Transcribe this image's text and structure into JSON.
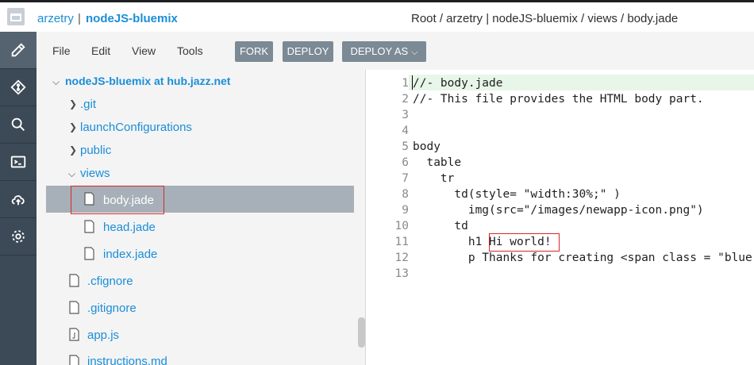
{
  "header": {
    "user": "arzetry",
    "separator": "|",
    "project": "nodeJS-bluemix",
    "path": "Root / arzetry | nodeJS-bluemix / views / body.jade"
  },
  "toolbar": {
    "menus": [
      "File",
      "Edit",
      "View",
      "Tools"
    ],
    "fork_label": "FORK",
    "deploy_label": "DEPLOY",
    "deploy_as_label": "DEPLOY AS"
  },
  "rail": {
    "icons": [
      "edit-icon",
      "git-icon",
      "search-icon",
      "terminal-icon",
      "cloud-upload-icon",
      "settings-icon"
    ]
  },
  "tree": {
    "root": "nodeJS-bluemix at hub.jazz.net",
    "folders": [
      ".git",
      "launchConfigurations",
      "public",
      "views"
    ],
    "views_files": [
      "body.jade",
      "head.jade",
      "index.jade"
    ],
    "root_files": [
      ".cfignore",
      ".gitignore",
      "app.js",
      "instructions.md"
    ],
    "selected": "body.jade"
  },
  "editor": {
    "line_numbers": [
      "1",
      "2",
      "3",
      "4",
      "5",
      "6",
      "7",
      "8",
      "9",
      "10",
      "11",
      "12",
      "13"
    ],
    "lines": [
      "//- body.jade",
      "//- This file provides the HTML body part.",
      "",
      "",
      "body",
      "  table",
      "    tr",
      "      td(style= \"width:30%;\" )",
      "        img(src=\"/images/newapp-icon.png\")",
      "      td",
      "        h1 Hi world!",
      "        p Thanks for creating <span class = \"blue\">",
      ""
    ],
    "highlighted_text": "Hi world!"
  },
  "colors": {
    "accent": "#1a8ed8",
    "rail": "#3b4a56",
    "button": "#7b8a95",
    "selection": "#a7b0b8",
    "highlight_border": "#d9262a"
  }
}
